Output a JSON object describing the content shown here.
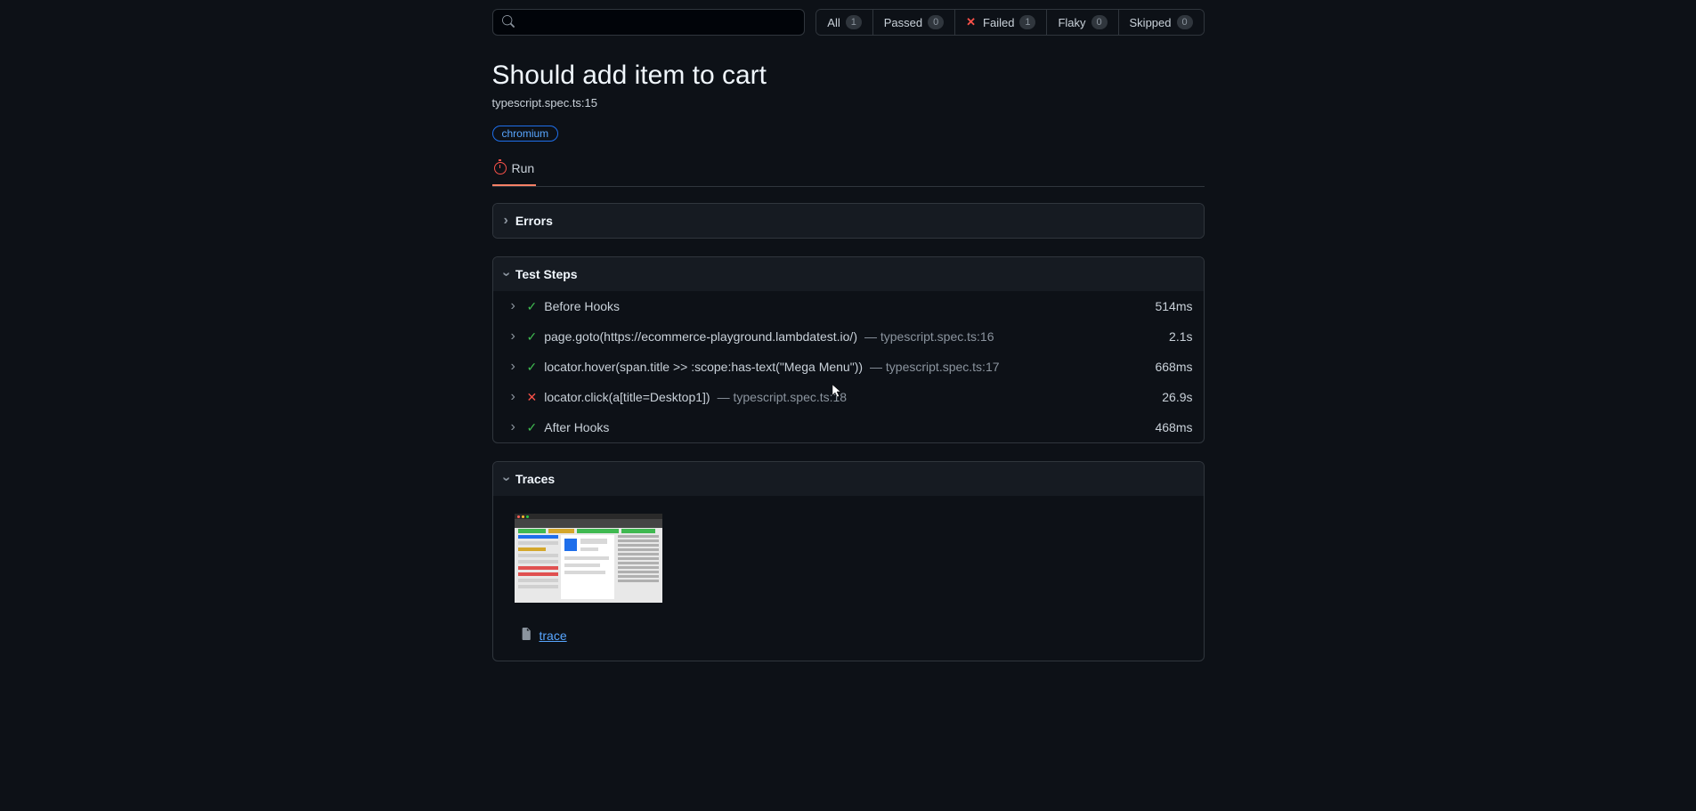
{
  "search": {
    "placeholder": ""
  },
  "filters": [
    {
      "id": "all",
      "label": "All",
      "count": "1",
      "icon": null
    },
    {
      "id": "passed",
      "label": "Passed",
      "count": "0",
      "icon": null
    },
    {
      "id": "failed",
      "label": "Failed",
      "count": "1",
      "icon": "x"
    },
    {
      "id": "flaky",
      "label": "Flaky",
      "count": "0",
      "icon": null
    },
    {
      "id": "skipped",
      "label": "Skipped",
      "count": "0",
      "icon": null
    }
  ],
  "test": {
    "title": "Should add item to cart",
    "location": "typescript.spec.ts:15",
    "project": "chromium",
    "run_tab": "Run"
  },
  "sections": {
    "errors": {
      "title": "Errors"
    },
    "steps": {
      "title": "Test Steps",
      "items": [
        {
          "status": "pass",
          "text": "Before Hooks",
          "meta": "",
          "time": "514ms"
        },
        {
          "status": "pass",
          "text": "page.goto(https://ecommerce-playground.lambdatest.io/)",
          "meta": " — typescript.spec.ts:16",
          "time": "2.1s"
        },
        {
          "status": "pass",
          "text": "locator.hover(span.title >> :scope:has-text(\"Mega Menu\"))",
          "meta": " — typescript.spec.ts:17",
          "time": "668ms"
        },
        {
          "status": "fail",
          "text": "locator.click(a[title=Desktop1])",
          "meta": " — typescript.spec.ts:18",
          "time": "26.9s"
        },
        {
          "status": "pass",
          "text": "After Hooks",
          "meta": "",
          "time": "468ms"
        }
      ]
    },
    "traces": {
      "title": "Traces",
      "link_label": "trace"
    }
  }
}
